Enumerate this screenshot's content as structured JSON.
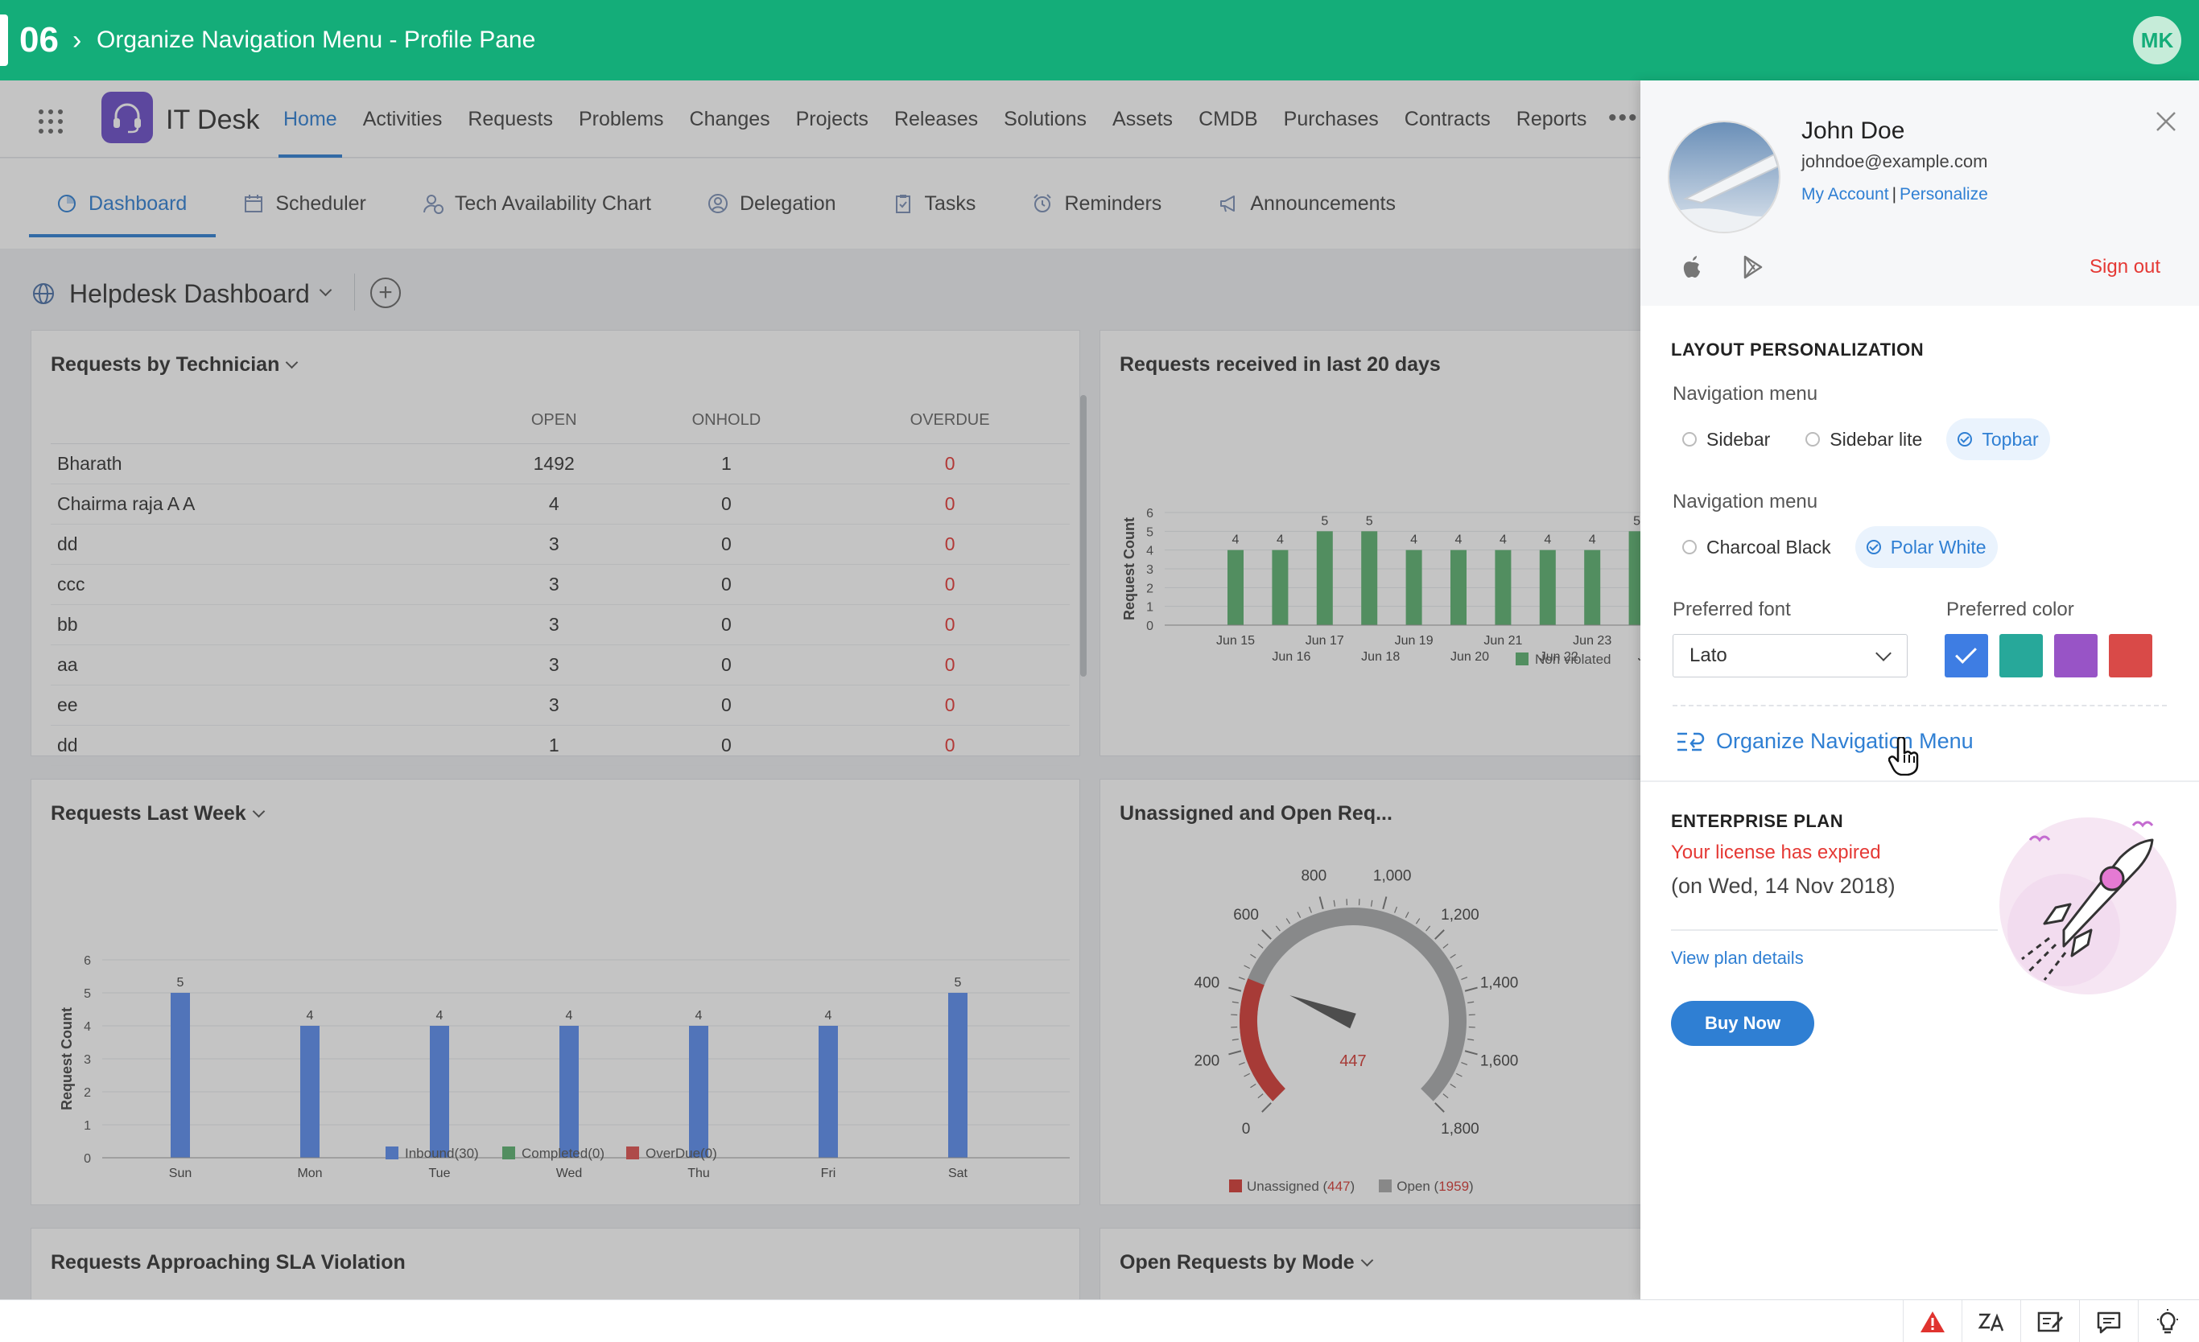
{
  "banner": {
    "step": "06",
    "separator": "›",
    "title": "Organize Navigation Menu - Profile Pane",
    "user_initials": "MK"
  },
  "topnav": {
    "app_name": "IT Desk",
    "items": [
      {
        "label": "Home",
        "active": true
      },
      {
        "label": "Activities"
      },
      {
        "label": "Requests"
      },
      {
        "label": "Problems"
      },
      {
        "label": "Changes"
      },
      {
        "label": "Projects"
      },
      {
        "label": "Releases"
      },
      {
        "label": "Solutions"
      },
      {
        "label": "Assets"
      },
      {
        "label": "CMDB"
      },
      {
        "label": "Purchases"
      },
      {
        "label": "Contracts"
      },
      {
        "label": "Reports"
      }
    ],
    "more": "•••"
  },
  "subtabs": [
    {
      "label": "Dashboard",
      "icon": "dashboard-icon",
      "active": true
    },
    {
      "label": "Scheduler",
      "icon": "calendar-icon"
    },
    {
      "label": "Tech Availability Chart",
      "icon": "user-clock-icon"
    },
    {
      "label": "Delegation",
      "icon": "delegation-icon"
    },
    {
      "label": "Tasks",
      "icon": "clipboard-icon"
    },
    {
      "label": "Reminders",
      "icon": "alarm-icon"
    },
    {
      "label": "Announcements",
      "icon": "megaphone-icon"
    }
  ],
  "dashboard": {
    "title": "Helpdesk Dashboard"
  },
  "requests_by_technician": {
    "title": "Requests by Technician",
    "columns": [
      "",
      "OPEN",
      "ONHOLD",
      "OVERDUE"
    ],
    "rows": [
      [
        "Bharath",
        "1492",
        "1",
        "0"
      ],
      [
        "Chairma raja A A",
        "4",
        "0",
        "0"
      ],
      [
        "dd",
        "3",
        "0",
        "0"
      ],
      [
        "ccc",
        "3",
        "0",
        "0"
      ],
      [
        "bb",
        "3",
        "0",
        "0"
      ],
      [
        "aa",
        "3",
        "0",
        "0"
      ],
      [
        "ee",
        "3",
        "0",
        "0"
      ],
      [
        "dd",
        "1",
        "0",
        "0"
      ]
    ]
  },
  "panels": {
    "requests_last_week": "Requests Last Week",
    "received_20_days": "Requests received in last 20 days",
    "unassigned_open": "Unassigned and Open Req...",
    "sla_violation": "Requests Approaching SLA Violation",
    "open_by_mode": "Open Requests by Mode"
  },
  "chart_data": [
    {
      "type": "bar",
      "title": "Requests received in last 20 days",
      "ylabel": "Request Count",
      "ylim": [
        0,
        6
      ],
      "yticks": [
        "0",
        "1",
        "2",
        "3",
        "4",
        "5",
        "6"
      ],
      "categories": [
        "Jun 15",
        "Jun 16",
        "Jun 17",
        "Jun 18",
        "Jun 19",
        "Jun 20",
        "Jun 21",
        "Jun 22",
        "Jun 23",
        "Jun"
      ],
      "series": [
        {
          "name": "Non violated",
          "color": "#5cb270",
          "values": [
            4,
            4,
            5,
            5,
            4,
            4,
            4,
            4,
            4,
            5
          ]
        }
      ],
      "legend": [
        "Non violated"
      ]
    },
    {
      "type": "bar",
      "title": "Requests Last Week",
      "ylabel": "Request Count",
      "ylim": [
        0,
        6
      ],
      "yticks": [
        "0",
        "1",
        "2",
        "3",
        "4",
        "5",
        "6"
      ],
      "categories": [
        "Sun",
        "Mon",
        "Tue",
        "Wed",
        "Thu",
        "Fri",
        "Sat"
      ],
      "series": [
        {
          "name": "Inbound(30)",
          "color": "#5b8def",
          "values": [
            5,
            4,
            4,
            4,
            4,
            4,
            5
          ]
        }
      ],
      "legend": [
        {
          "label": "Inbound(30)",
          "color": "#5b8def"
        },
        {
          "label": "Completed(0)",
          "color": "#5cb270"
        },
        {
          "label": "OverDue(0)",
          "color": "#e0514f"
        }
      ]
    },
    {
      "type": "gauge",
      "title": "Unassigned and Open Req...",
      "min": 0,
      "max": 1800,
      "ticks": [
        "0",
        "200",
        "400",
        "600",
        "800",
        "1,000",
        "1,200",
        "1,400",
        "1,600",
        "1,800"
      ],
      "value": 447,
      "value_label": "447",
      "legend": [
        {
          "label": "Unassigned",
          "count": "447",
          "color": "#d63b35"
        },
        {
          "label": "Open",
          "count": "1959",
          "color": "#aaaaaa"
        }
      ]
    }
  ],
  "profile": {
    "name": "John Doe",
    "email": "johndoe@example.com",
    "my_account": "My Account",
    "link_sep": "|",
    "personalize": "Personalize",
    "sign_out": "Sign out",
    "layout_title": "LAYOUT PERSONALIZATION",
    "nav_menu_label": "Navigation menu",
    "nav_options": [
      {
        "label": "Sidebar"
      },
      {
        "label": "Sidebar lite"
      },
      {
        "label": "Topbar",
        "selected": true
      }
    ],
    "theme_label": "Navigation menu",
    "theme_options": [
      {
        "label": "Charcoal Black"
      },
      {
        "label": "Polar White",
        "selected": true
      }
    ],
    "font_label": "Preferred font",
    "font_value": "Lato",
    "color_label": "Preferred color",
    "colors": [
      "#3e7de3",
      "#27a89a",
      "#9854c6",
      "#d94a48"
    ],
    "selected_color": "#3e7de3",
    "organize_link": "Organize Navigation Menu",
    "plan_title": "ENTERPRISE PLAN",
    "license_expired": "Your license has expired",
    "license_date": "(on Wed, 14 Nov 2018)",
    "view_plan": "View plan details",
    "buy_now": "Buy Now"
  }
}
